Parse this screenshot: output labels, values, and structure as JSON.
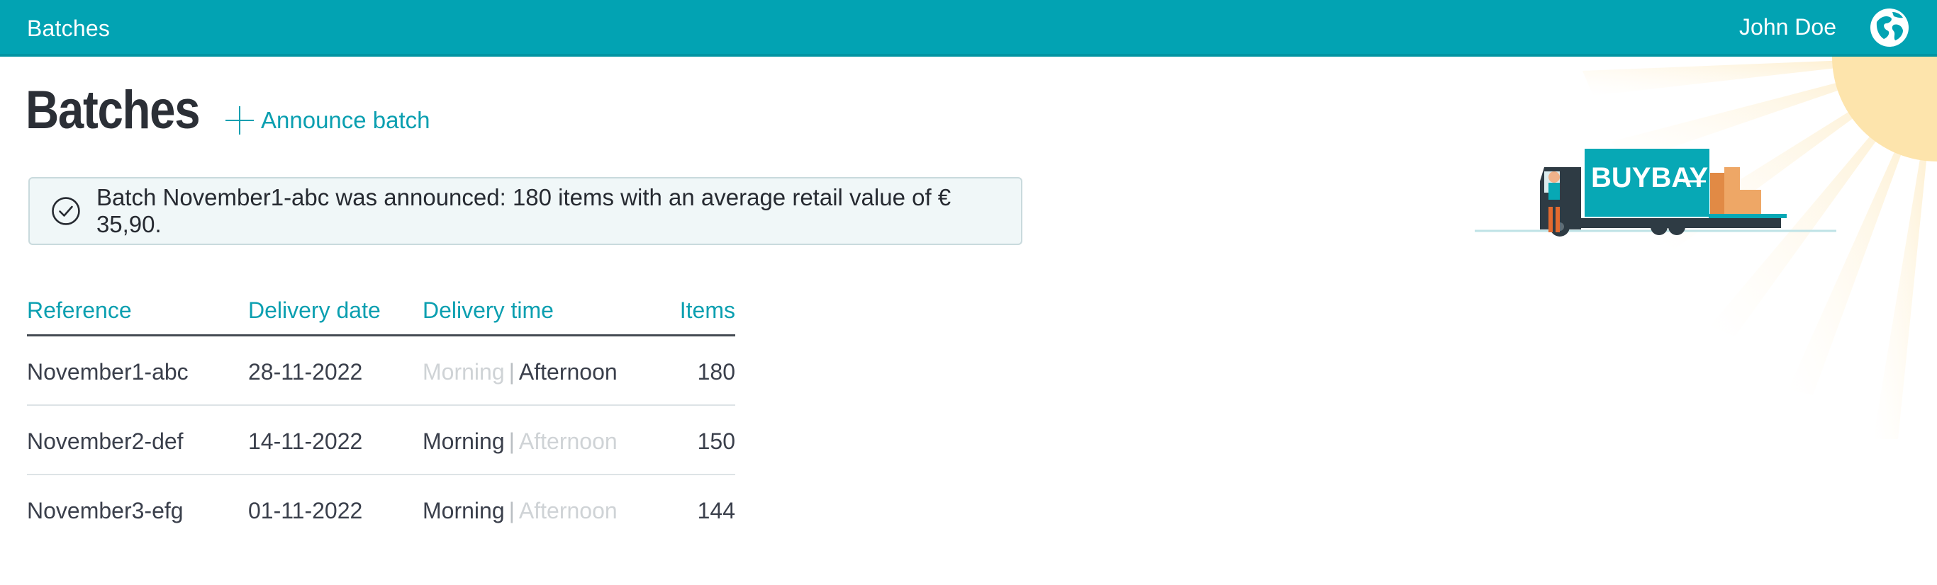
{
  "header": {
    "app_title": "Batches",
    "user_name": "John Doe",
    "globe_icon": "globe-icon"
  },
  "page": {
    "title": "Batches",
    "announce_label": "Announce batch"
  },
  "notification": {
    "message": "Batch November1-abc was announced: 180 items with an average retail value of € 35,90.",
    "icon": "check-circle-icon"
  },
  "illustration": {
    "truck_brand": "BUYBAY"
  },
  "table": {
    "columns": [
      "Reference",
      "Delivery date",
      "Delivery time",
      "Items"
    ],
    "time_options": [
      "Morning",
      "Afternoon"
    ],
    "rows": [
      {
        "reference": "November1-abc",
        "date": "28-11-2022",
        "selected_time": "Afternoon",
        "items": "180"
      },
      {
        "reference": "November2-def",
        "date": "14-11-2022",
        "selected_time": "Morning",
        "items": "150"
      },
      {
        "reference": "November3-efg",
        "date": "01-11-2022",
        "selected_time": "Morning",
        "items": "144"
      }
    ]
  },
  "colors": {
    "accent": "#02a3b3",
    "link": "#0a9fb0",
    "text": "#3a3f4b",
    "muted": "#cfd3d6",
    "sun": "#fde6b0"
  }
}
